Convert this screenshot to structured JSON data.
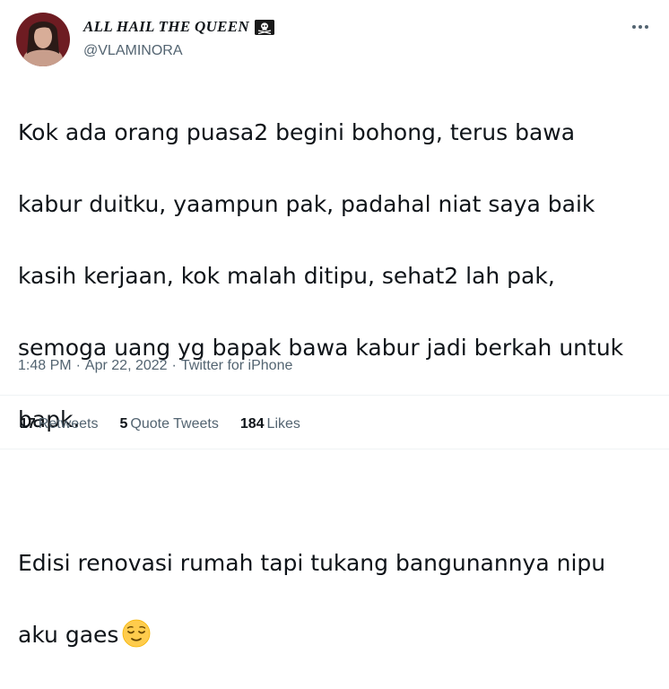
{
  "author": {
    "display_name": "ALL HAIL THE QUEEN",
    "handle": "@VLAMINORA",
    "badge_icon": "skull-and-crossbones-icon"
  },
  "tweet": {
    "lines": [
      "Kok ada orang puasa2 begini bohong, terus bawa",
      "kabur duitku, yaampun pak, padahal niat saya baik",
      "kasih kerjaan, kok malah ditipu, sehat2 lah pak,",
      "semoga uang yg bapak bawa kabur jadi berkah untuk",
      "bapk.",
      "",
      "Edisi renovasi rumah tapi tukang bangunannya nipu",
      "aku gaes"
    ],
    "emoji": "relieved-face-icon"
  },
  "meta": {
    "time": "1:48 PM",
    "date": "Apr 22, 2022",
    "source": "Twitter for iPhone",
    "separator": "·"
  },
  "stats": {
    "retweets_count": "17",
    "retweets_label": "Retweets",
    "quote_count": "5",
    "quote_label": "Quote Tweets",
    "likes_count": "184",
    "likes_label": "Likes"
  },
  "colors": {
    "text": "#0f1419",
    "secondary": "#536471",
    "divider": "#eff3f4"
  }
}
